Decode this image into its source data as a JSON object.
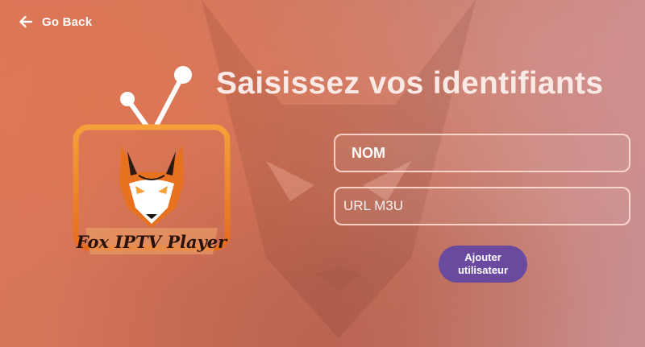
{
  "nav": {
    "back_label": "Go Back",
    "back_icon": "arrow-left-icon"
  },
  "logo": {
    "icon": "fox-tv-logo",
    "text": "Fox IPTV Player"
  },
  "heading": {
    "title": "Saisissez vos identifiants"
  },
  "form": {
    "name_value": "NOM",
    "url_placeholder": "URL M3U",
    "submit_label": "Ajouter utilisateur"
  },
  "colors": {
    "button": "#6a4a9e",
    "title_text": "#fbe9e6",
    "field_border": "#ffe1d7"
  }
}
